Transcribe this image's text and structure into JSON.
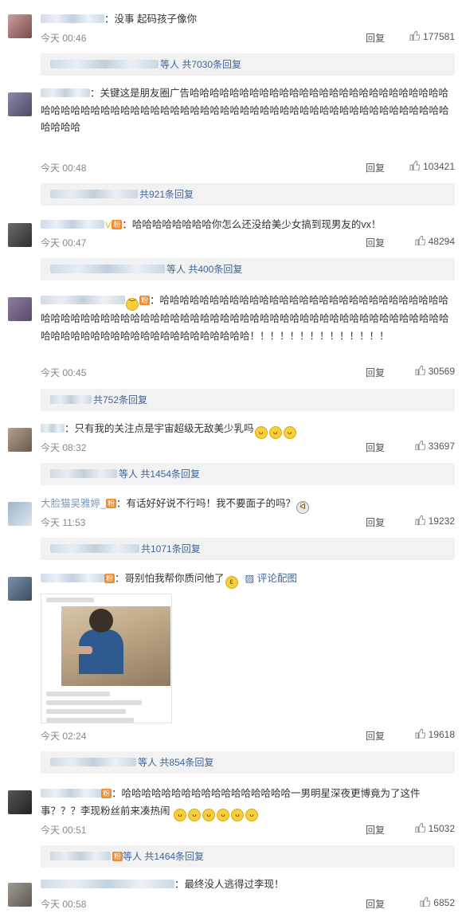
{
  "reply_label": "回复",
  "pic_link": "评论配图",
  "comments": [
    {
      "text": "没事 起码孩子像你",
      "time": "今天 00:46",
      "likes": "177581",
      "replies": "等人 共7030条回复"
    },
    {
      "text": "关键这是朋友圈广告哈哈哈哈哈哈哈哈哈哈哈哈哈哈哈哈哈哈哈哈哈哈哈哈哈哈哈哈哈哈哈哈哈哈哈哈哈哈哈哈哈哈哈哈哈哈哈哈哈哈哈哈哈哈哈哈哈哈哈哈哈哈哈哈哈哈哈哈哈哈哈",
      "time": "今天 00:48",
      "likes": "103421",
      "replies": "共921条回复"
    },
    {
      "text": "哈哈哈哈哈哈哈哈你怎么还没给美少女搞到现男友的vx！",
      "time": "今天 00:47",
      "likes": "48294",
      "replies": "等人 共400条回复"
    },
    {
      "text": "哈哈哈哈哈哈哈哈哈哈哈哈哈哈哈哈哈哈哈哈哈哈哈哈哈哈哈哈哈哈哈哈哈哈哈哈哈哈哈哈哈哈哈哈哈哈哈哈哈哈哈哈哈哈哈哈哈哈哈哈哈哈哈哈哈哈哈哈哈哈哈哈哈哈哈哈哈哈哈哈哈哈哈哈哈哈哈哈哈哈哈！！！！！！！！！！！！！！",
      "time": "今天 00:45",
      "likes": "30569",
      "replies": "共752条回复"
    },
    {
      "text": "只有我的关注点是宇宙超级无敌美少乳吗",
      "time": "今天 08:32",
      "likes": "33697",
      "replies": "等人 共1454条回复"
    },
    {
      "name": "大脸猫吴雅婷_",
      "text": "有话好好说不行吗！我不要面子的吗？",
      "time": "今天 11:53",
      "likes": "19232",
      "replies": "共1071条回复"
    },
    {
      "text": "哥别怕我帮你质问他了",
      "time": "今天 02:24",
      "likes": "19618",
      "replies": "等人 共854条回复"
    },
    {
      "text": "哈哈哈哈哈哈哈哈哈哈哈哈哈哈哈哈哈一男明星深夜更博竟为了这件事？？？李现粉丝前来凑热闹",
      "time": "今天 00:51",
      "likes": "15032",
      "replies": "等人 共1464条回复"
    },
    {
      "text": "最终没人逃得过李现！",
      "time": "今天 00:58",
      "likes": "6852"
    }
  ],
  "colors": {
    "link": "#3f6599",
    "muted": "#888888",
    "reply_bg": "#f2f2f2"
  },
  "icons": [
    "thumb-up-icon",
    "picture-icon",
    "emoji-icon",
    "vip-badge-icon"
  ]
}
